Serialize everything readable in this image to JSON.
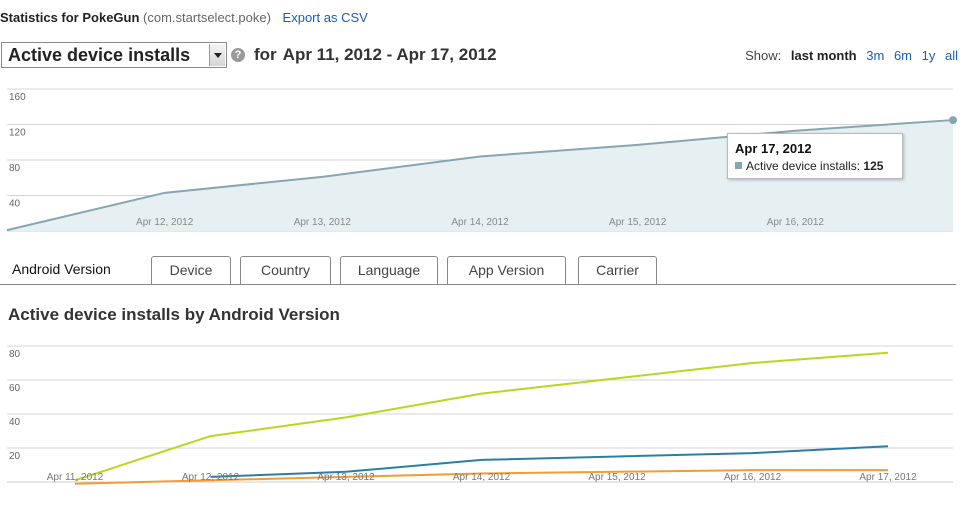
{
  "header": {
    "prefix": "Statistics for PokeGun",
    "package": "(com.startselect.poke)",
    "export_label": "Export as CSV"
  },
  "controls": {
    "metric_select": "Active device installs",
    "help_label": "?",
    "for_label": "for",
    "date_range": "Apr 11, 2012 - Apr 17, 2012",
    "show_label": "Show:",
    "ranges": [
      "last month",
      "3m",
      "6m",
      "1y",
      "all"
    ]
  },
  "tooltip": {
    "title": "Apr 17, 2012",
    "series_label": "Active device installs:",
    "value": "125"
  },
  "tabs": [
    "Android Version",
    "Device",
    "Country",
    "Language",
    "App Version",
    "Carrier"
  ],
  "section_title": "Active device installs by Android Version",
  "colors": {
    "main_line": "#87a6b2",
    "main_fill": "#e6f0f3",
    "series_green": "#b7d81e",
    "series_blue": "#2b7ea6",
    "series_orange": "#f59b35",
    "link": "#1a5eb5"
  },
  "chart_data": [
    {
      "type": "area",
      "x": [
        "Apr 11, 2012",
        "Apr 12, 2012",
        "Apr 13, 2012",
        "Apr 14, 2012",
        "Apr 15, 2012",
        "Apr 16, 2012",
        "Apr 17, 2012"
      ],
      "x_tick_labels": [
        "Apr 12, 2012",
        "Apr 13, 2012",
        "Apr 14, 2012",
        "Apr 15, 2012",
        "Apr 16, 2012"
      ],
      "series": [
        {
          "values": [
            1,
            43,
            61,
            84,
            97,
            113,
            125
          ]
        }
      ],
      "y_ticks": [
        40,
        80,
        120,
        160
      ],
      "ylim": [
        0,
        160
      ],
      "grid": true
    },
    {
      "type": "line",
      "x": [
        "Apr 11, 2012",
        "Apr 12, 2012",
        "Apr 13, 2012",
        "Apr 14, 2012",
        "Apr 15, 2012",
        "Apr 16, 2012",
        "Apr 17, 2012"
      ],
      "x_tick_labels": [
        "Apr 11, 2012",
        "Apr 12, 2012",
        "Apr 13, 2012",
        "Apr 14, 2012",
        "Apr 15, 2012",
        "Apr 16, 2012",
        "Apr 17, 2012"
      ],
      "series": [
        {
          "color": "#b7d81e",
          "values": [
            1,
            27,
            38,
            52,
            61,
            70,
            76
          ]
        },
        {
          "color": "#2b7ea6",
          "values": [
            null,
            3,
            6,
            13,
            15,
            17,
            21
          ]
        },
        {
          "color": "#f59b35",
          "values": [
            -1,
            1,
            3,
            5,
            6,
            7,
            7
          ]
        }
      ],
      "y_ticks": [
        20,
        40,
        60,
        80
      ],
      "ylim": [
        0,
        80
      ],
      "grid": true
    }
  ]
}
